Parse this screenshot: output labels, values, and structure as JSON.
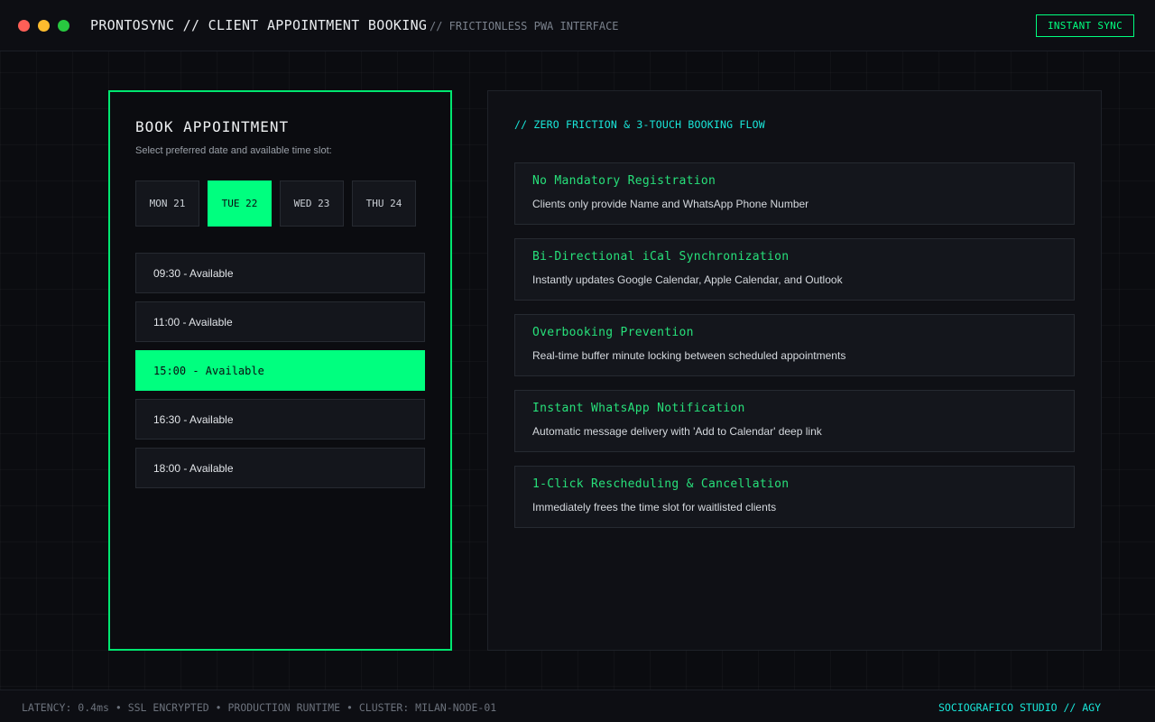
{
  "colors": {
    "background": "#0b0c10",
    "accent_green": "#00ff7f",
    "accent_cyan": "#19e6d9",
    "feature_title": "#27e07a",
    "window_red": "#ff5f57",
    "window_yellow": "#febc2e",
    "window_green": "#28c840"
  },
  "header": {
    "title": "PRONTOSYNC // CLIENT APPOINTMENT BOOKING",
    "subtitle": "// FRICTIONLESS PWA INTERFACE",
    "sync_button": "INSTANT SYNC"
  },
  "booking": {
    "title": "BOOK APPOINTMENT",
    "subtitle": "Select preferred date and available time slot:",
    "days": [
      {
        "label": "MON 21",
        "selected": false
      },
      {
        "label": "TUE 22",
        "selected": true
      },
      {
        "label": "WED 23",
        "selected": false
      },
      {
        "label": "THU 24",
        "selected": false
      }
    ],
    "slots": [
      {
        "label": "09:30 - Available",
        "selected": false
      },
      {
        "label": "11:00 - Available",
        "selected": false
      },
      {
        "label": "15:00 - Available",
        "selected": true
      },
      {
        "label": "16:30 - Available",
        "selected": false
      },
      {
        "label": "18:00 - Available",
        "selected": false
      }
    ]
  },
  "features": {
    "heading": "// ZERO FRICTION & 3-TOUCH BOOKING FLOW",
    "items": [
      {
        "title": "No Mandatory Registration",
        "description": "Clients only provide Name and WhatsApp Phone Number"
      },
      {
        "title": "Bi-Directional iCal Synchronization",
        "description": "Instantly updates Google Calendar, Apple Calendar, and Outlook"
      },
      {
        "title": "Overbooking Prevention",
        "description": "Real-time buffer minute locking between scheduled appointments"
      },
      {
        "title": "Instant WhatsApp Notification",
        "description": "Automatic message delivery with 'Add to Calendar' deep link"
      },
      {
        "title": "1-Click Rescheduling & Cancellation",
        "description": "Immediately frees the time slot for waitlisted clients"
      }
    ]
  },
  "footer": {
    "status": "LATENCY: 0.4ms • SSL ENCRYPTED • PRODUCTION RUNTIME • CLUSTER: MILAN-NODE-01",
    "brand": "SOCIOGRAFICO STUDIO // AGY"
  }
}
